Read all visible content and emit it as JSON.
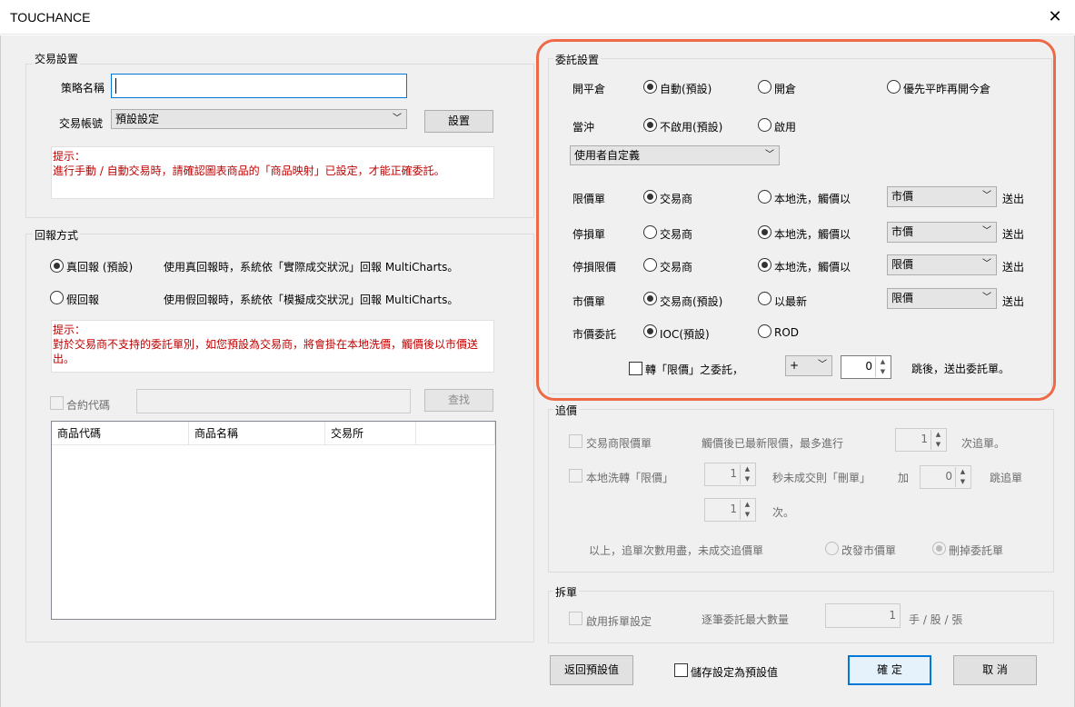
{
  "window": {
    "title": "TOUCHANCE",
    "close_glyph": "✕"
  },
  "trade_settings": {
    "legend": "交易設置",
    "strategy_label": "策略名稱",
    "strategy_value": "",
    "account_label": "交易帳號",
    "account_value": "預設設定",
    "settings_button": "設置",
    "hint": "提示：\n進行手動 / 自動交易時，請確認圖表商品的「商品映射」已設定，才能正確委託。"
  },
  "report_mode": {
    "legend": "回報方式",
    "real_label": "真回報 (預設)",
    "real_desc": "使用真回報時，系統依「實際成交狀況」回報 MultiCharts。",
    "fake_label": "假回報",
    "fake_desc": "使用假回報時，系統依「模擬成交狀況」回報 MultiCharts。",
    "hint": "提示：\n對於交易商不支持的委託單別，如您預設為交易商，將會掛在本地洗價，觸價後以市價送出。",
    "contract_label": "合約代碼",
    "search_button": "查找",
    "columns": [
      "商品代碼",
      "商品名稱",
      "交易所",
      ""
    ]
  },
  "order_settings": {
    "legend": "委託設置",
    "open_close": {
      "label": "開平倉",
      "opt1": "自動(預設)",
      "opt2": "開倉",
      "opt3": "優先平昨再開今倉"
    },
    "daytrade": {
      "label": "當沖",
      "opt1": "不啟用(預設)",
      "opt2": "啟用"
    },
    "custom_combo": "使用者自定義",
    "limit": {
      "label": "限價單",
      "opt1": "交易商",
      "opt2": "本地洗，觸價以",
      "combo": "市價",
      "send": "送出"
    },
    "stop": {
      "label": "停損單",
      "opt1": "交易商",
      "opt2": "本地洗，觸價以",
      "combo": "市價",
      "send": "送出"
    },
    "stop_limit": {
      "label": "停損限價",
      "opt1": "交易商",
      "opt2": "本地洗，觸價以",
      "combo": "限價",
      "send": "送出"
    },
    "market": {
      "label": "市價單",
      "opt1": "交易商(預設)",
      "opt2": "以最新",
      "combo": "限價",
      "send": "送出"
    },
    "market_order": {
      "label": "市價委託",
      "opt1": "IOC(預設)",
      "opt2": "ROD"
    },
    "convert": {
      "label": "轉「限價」之委託，",
      "sign": "+",
      "ticks": "0",
      "suffix": "跳後，送出委託單。"
    }
  },
  "chase": {
    "legend": "追價",
    "broker_limit": "交易商限價單",
    "broker_desc": "觸價後已最新限價，最多進行",
    "broker_count": "1",
    "broker_suffix": "次追單。",
    "local_limit": "本地洗轉「限價」",
    "local_secs": "1",
    "local_desc": "秒未成交則「刪單」",
    "add_label": "加",
    "add_ticks": "0",
    "add_suffix": "跳追單",
    "times_value": "1",
    "times_suffix": "次。",
    "exhausted": "以上，追單次數用盡，未成交追價單",
    "opt_market": "改發市價單",
    "opt_delete": "刪掉委託單"
  },
  "split": {
    "legend": "拆單",
    "enable": "啟用拆單設定",
    "max_label": "逐筆委託最大數量",
    "max_value": "1",
    "unit": "手 / 股 / 張"
  },
  "footer": {
    "reset": "返回預設值",
    "save_default": "儲存設定為預設值",
    "ok": "確 定",
    "cancel": "取 消"
  }
}
